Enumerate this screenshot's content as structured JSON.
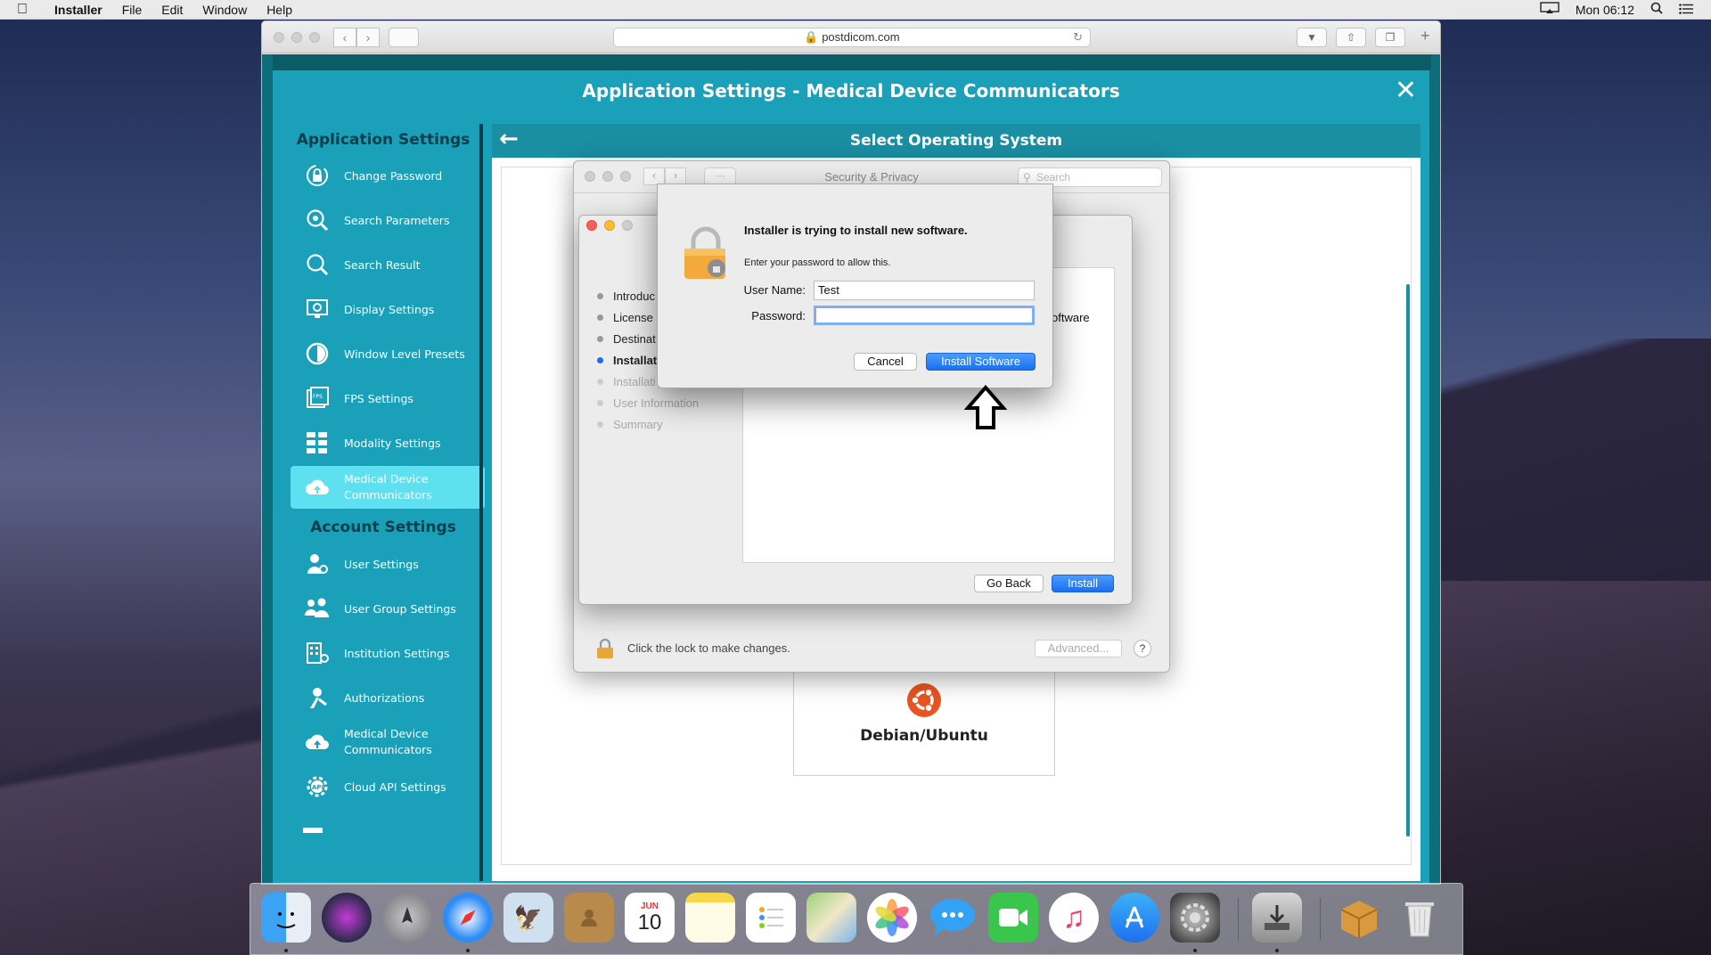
{
  "menubar": {
    "app_name": "Installer",
    "items": [
      "File",
      "Edit",
      "Window",
      "Help"
    ],
    "clock": "Mon 06:12"
  },
  "browser": {
    "url": "postdicom.com"
  },
  "modal": {
    "title": "Application Settings - Medical Device Communicators"
  },
  "sidebar": {
    "app_heading": "Application Settings",
    "account_heading": "Account Settings",
    "app_items": [
      {
        "label": "Change Password",
        "icon": "lock-refresh-icon"
      },
      {
        "label": "Search Parameters",
        "icon": "search-gear-icon"
      },
      {
        "label": "Search Result",
        "icon": "search-icon"
      },
      {
        "label": "Display Settings",
        "icon": "monitor-gear-icon"
      },
      {
        "label": "Window Level Presets",
        "icon": "contrast-icon"
      },
      {
        "label": "FPS Settings",
        "icon": "fps-icon"
      },
      {
        "label": "Modality Settings",
        "icon": "grid-icon"
      },
      {
        "label": "Medical Device Communicators",
        "icon": "cloud-upload-icon"
      }
    ],
    "account_items": [
      {
        "label": "User Settings",
        "icon": "user-gear-icon"
      },
      {
        "label": "User Group Settings",
        "icon": "user-group-icon"
      },
      {
        "label": "Institution Settings",
        "icon": "institution-icon"
      },
      {
        "label": "Authorizations",
        "icon": "key-user-icon"
      },
      {
        "label": "Medical Device Communicators",
        "icon": "cloud-upload-icon"
      },
      {
        "label": "Cloud API Settings",
        "icon": "api-gear-icon"
      }
    ]
  },
  "content": {
    "title": "Select Operating System",
    "os_card_label": "Debian/Ubuntu"
  },
  "security_window": {
    "title": "Security & Privacy",
    "search_placeholder": "Search",
    "lock_text": "Click the lock to make changes.",
    "advanced_label": "Advanced...",
    "help_label": "?"
  },
  "installer": {
    "steps": [
      {
        "label": "Introduc",
        "state": "done"
      },
      {
        "label": "License",
        "state": "done"
      },
      {
        "label": "Destinat",
        "state": "done"
      },
      {
        "label": "Installat",
        "state": "active"
      },
      {
        "label": "Installati",
        "state": "pending"
      },
      {
        "label": "User Information",
        "state": "pending"
      },
      {
        "label": "Summary",
        "state": "pending"
      }
    ],
    "panel_text": "oftware",
    "go_back_label": "Go Back",
    "install_label": "Install"
  },
  "auth_dialog": {
    "title": "Installer is trying to install new software.",
    "subtitle": "Enter your password to allow this.",
    "username_label": "User Name:",
    "username_value": "Test",
    "password_label": "Password:",
    "password_value": "",
    "cancel_label": "Cancel",
    "install_label": "Install Software"
  },
  "dock": {
    "calendar_month": "JUN",
    "calendar_day": "10"
  },
  "colors": {
    "teal": "#1aa0b9",
    "teal_dark": "#1a8ea3",
    "active_item": "#5fe0f0",
    "mac_blue": "#1a6ff0",
    "ubuntu_orange": "#e95420"
  }
}
